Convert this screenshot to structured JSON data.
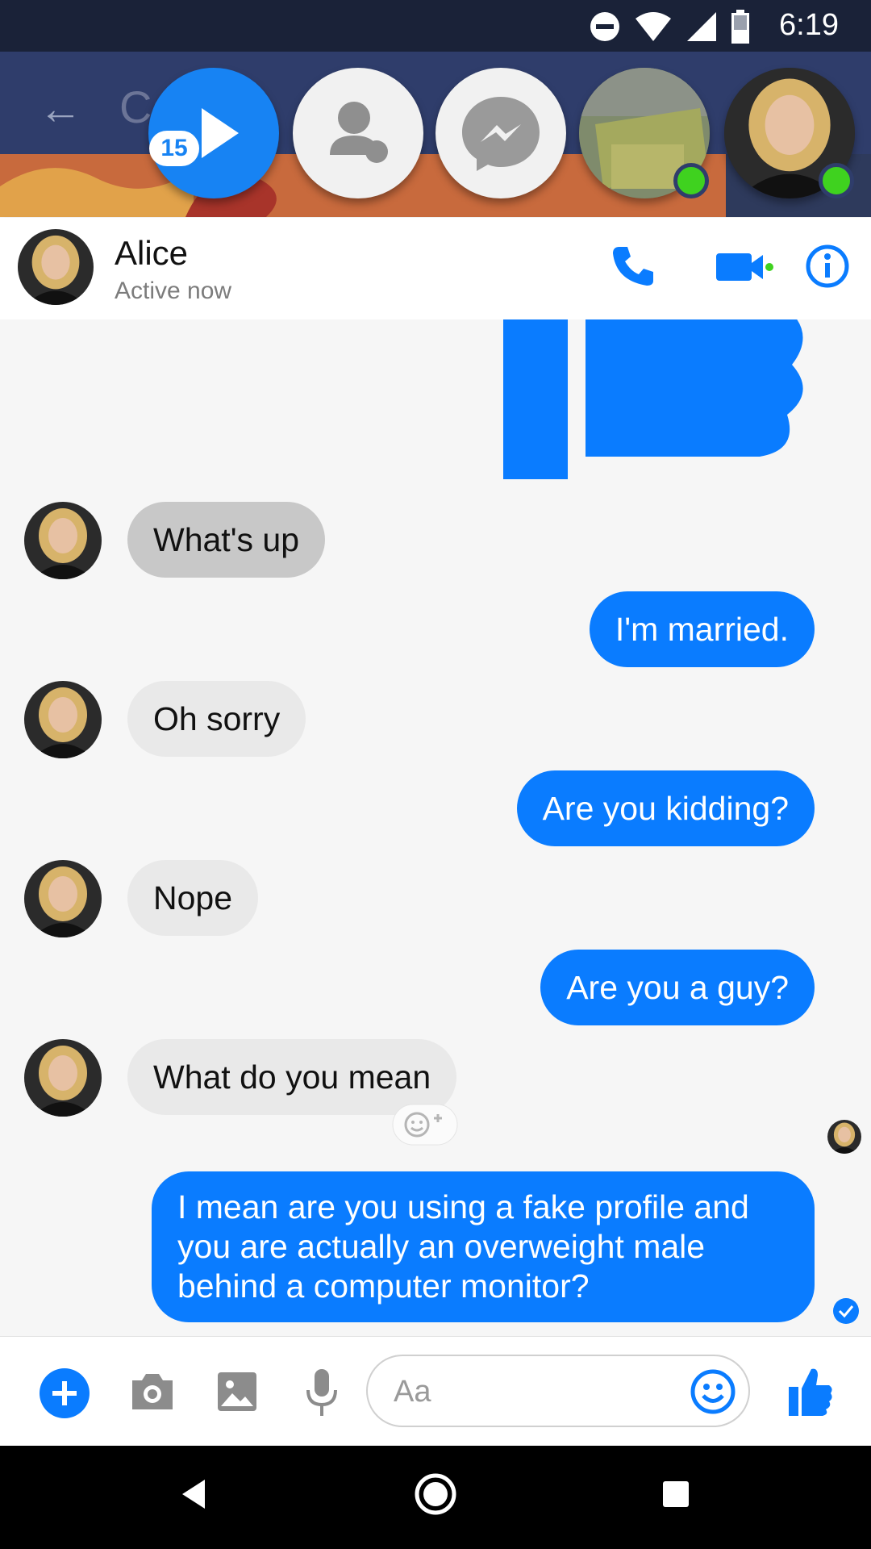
{
  "status_bar": {
    "time": "6:19"
  },
  "chat_heads": {
    "badge_count": "15"
  },
  "app_bar": {
    "faint_title": "Co"
  },
  "conversation": {
    "name": "Alice",
    "status": "Active now"
  },
  "messages": [
    {
      "from": "them",
      "text": "What's up"
    },
    {
      "from": "me",
      "text": "I'm married."
    },
    {
      "from": "them",
      "text": "Oh sorry"
    },
    {
      "from": "me",
      "text": "Are you kidding?"
    },
    {
      "from": "them",
      "text": "Nope"
    },
    {
      "from": "me",
      "text": "Are you a guy?"
    },
    {
      "from": "them",
      "text": "What do you mean"
    },
    {
      "from": "me",
      "text": "I mean are you using a fake profile and you are actually an overweight male behind a computer monitor?"
    }
  ],
  "composer": {
    "placeholder": "Aa"
  },
  "colors": {
    "accent": "#0a7cff",
    "online": "#3fd21f",
    "header_dark": "#2f3d6b"
  }
}
